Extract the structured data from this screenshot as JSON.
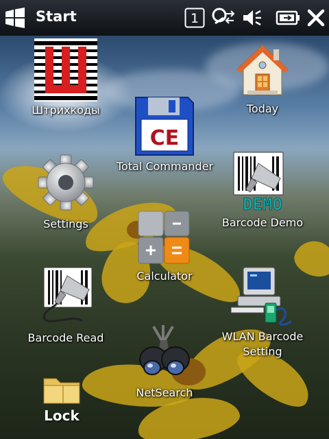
{
  "topbar": {
    "title": "Start",
    "notification_count": "1"
  },
  "apps": {
    "barcodes": "Штрихкоды",
    "today": "Today",
    "total_commander": "Total Commander",
    "total_commander_badge": "CE",
    "settings": "Settings",
    "barcode_demo": "Barcode Demo",
    "barcode_demo_badge": "DEMO",
    "calculator": "Calculator",
    "barcode_read": "Barcode Read",
    "wlan_barcode_setting": "WLAN Barcode Setting",
    "netsearch": "NetSearch"
  },
  "lock": {
    "label": "Lock"
  },
  "colors": {
    "accent_red": "#d81e1e",
    "flower_yellow": "#c9a418",
    "sky_blue": "#5a7fa6"
  }
}
